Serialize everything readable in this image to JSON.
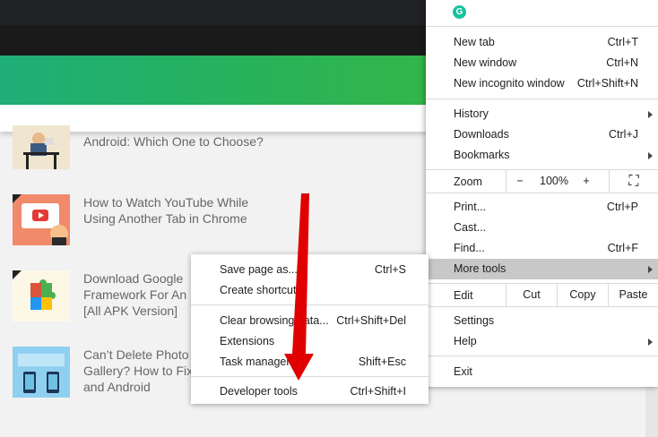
{
  "page": {
    "articles": [
      {
        "title_line1": "",
        "title_line2": "Android: Which One to Choose?"
      },
      {
        "title_line1": "How to Watch YouTube While",
        "title_line2": "Using Another Tab in Chrome"
      },
      {
        "title_line1": "Download Google",
        "title_line2": "Framework For An",
        "title_line3": "[All APK Version]"
      },
      {
        "title_line1": "Can’t Delete Photo",
        "title_line2": "Gallery? How to Fix",
        "title_line3": "and Android"
      }
    ]
  },
  "menu": {
    "grammarly_label": "G",
    "new_tab": {
      "label": "New tab",
      "shortcut": "Ctrl+T"
    },
    "new_window": {
      "label": "New window",
      "shortcut": "Ctrl+N"
    },
    "new_incognito": {
      "label": "New incognito window",
      "shortcut": "Ctrl+Shift+N"
    },
    "history": {
      "label": "History"
    },
    "downloads": {
      "label": "Downloads",
      "shortcut": "Ctrl+J"
    },
    "bookmarks": {
      "label": "Bookmarks"
    },
    "zoom": {
      "label": "Zoom",
      "minus": "−",
      "value": "100%",
      "plus": "+",
      "fullscreen": "⛶"
    },
    "print": {
      "label": "Print...",
      "shortcut": "Ctrl+P"
    },
    "cast": {
      "label": "Cast..."
    },
    "find": {
      "label": "Find...",
      "shortcut": "Ctrl+F"
    },
    "more_tools": {
      "label": "More tools"
    },
    "edit": {
      "label": "Edit",
      "cut": "Cut",
      "copy": "Copy",
      "paste": "Paste"
    },
    "settings": {
      "label": "Settings"
    },
    "help": {
      "label": "Help"
    },
    "exit": {
      "label": "Exit"
    }
  },
  "submenu": {
    "save_page": {
      "label": "Save page as...",
      "shortcut": "Ctrl+S"
    },
    "create_shortcut": {
      "label": "Create shortcut..."
    },
    "clear_data": {
      "label": "Clear browsing data...",
      "shortcut": "Ctrl+Shift+Del"
    },
    "extensions": {
      "label": "Extensions"
    },
    "task_manager": {
      "label": "Task manager",
      "shortcut": "Shift+Esc"
    },
    "developer_tools": {
      "label": "Developer tools",
      "shortcut": "Ctrl+Shift+I"
    }
  },
  "colors": {
    "accent_green": "#27b25c",
    "highlight": "#c8c8c8",
    "annotation_arrow": "#e00000"
  }
}
